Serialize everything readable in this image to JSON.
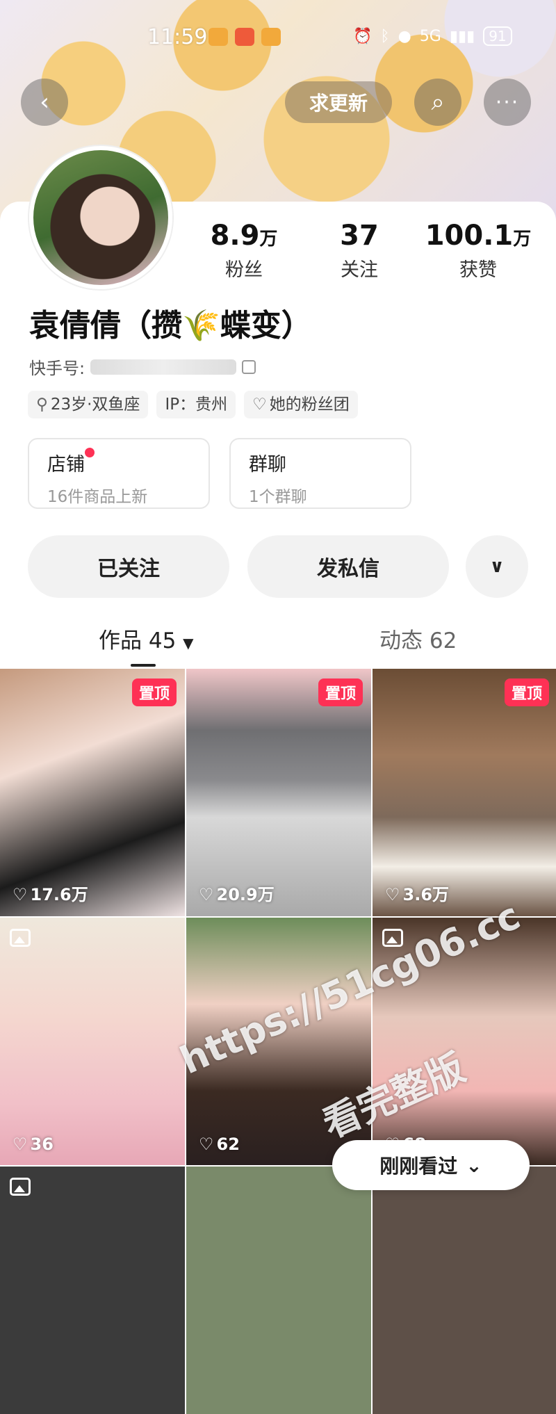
{
  "status_bar": {
    "time": "11:59",
    "battery": "91",
    "network": "5G"
  },
  "header": {
    "back_icon": "‹",
    "update_label": "求更新",
    "search_icon": "⌕",
    "more_icon": "···"
  },
  "profile": {
    "name": "袁倩倩（攒🌾蝶变）",
    "stats": {
      "fans": {
        "value": "8.9",
        "unit": "万",
        "label": "粉丝"
      },
      "following": {
        "value": "37",
        "unit": "",
        "label": "关注"
      },
      "likes": {
        "value": "100.1",
        "unit": "万",
        "label": "获赞"
      }
    },
    "id_label": "快手号:",
    "tags": [
      "23岁·双鱼座",
      "IP：贵州",
      "她的粉丝团"
    ],
    "shop": {
      "title": "店铺",
      "subtitle": "16件商品上新"
    },
    "group": {
      "title": "群聊",
      "subtitle": "1个群聊"
    }
  },
  "actions": {
    "followed": "已关注",
    "message": "发私信",
    "more_icon": "∨"
  },
  "tabs": {
    "works": "作品 45",
    "moments": "动态 62"
  },
  "grid": {
    "pinned_label": "置顶",
    "tiles": [
      {
        "likes": "17.6万"
      },
      {
        "likes": "20.9万"
      },
      {
        "likes": "3.6万"
      },
      {
        "likes": "36"
      },
      {
        "likes": "62"
      },
      {
        "likes": "68"
      }
    ]
  },
  "watermark": {
    "line1": "https://51cg06.cc",
    "line2": "看完整版"
  },
  "recent_pill": {
    "label": "刚刚看过",
    "icon": "⌄"
  },
  "colors": {
    "accent": "#fe3155",
    "pill_bg": "#f2f2f2"
  }
}
